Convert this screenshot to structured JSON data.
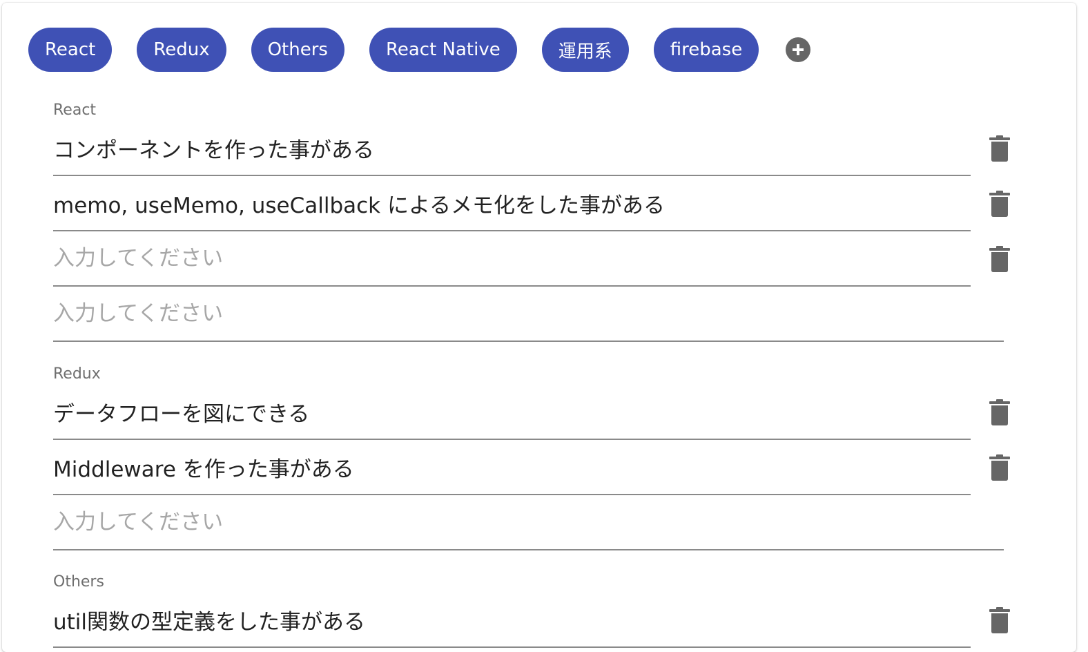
{
  "tabs": [
    {
      "label": "React"
    },
    {
      "label": "Redux"
    },
    {
      "label": "Others"
    },
    {
      "label": "React Native"
    },
    {
      "label": "運用系"
    },
    {
      "label": "firebase"
    }
  ],
  "sections": [
    {
      "label": "React",
      "items": [
        {
          "value": "コンポーネントを作った事がある",
          "placeholder": "入力してください"
        },
        {
          "value": "memo, useMemo, useCallback によるメモ化をした事がある",
          "placeholder": "入力してください"
        },
        {
          "value": "",
          "placeholder": "入力してください"
        }
      ],
      "new_item": {
        "value": "",
        "placeholder": "入力してください"
      }
    },
    {
      "label": "Redux",
      "items": [
        {
          "value": "データフローを図にできる",
          "placeholder": "入力してください"
        },
        {
          "value": "Middleware を作った事がある",
          "placeholder": "入力してください"
        }
      ],
      "new_item": {
        "value": "",
        "placeholder": "入力してください"
      }
    },
    {
      "label": "Others",
      "items": [
        {
          "value": "util関数の型定義をした事がある",
          "placeholder": "入力してください"
        }
      ]
    }
  ],
  "icons": {
    "add": "add-circle-icon",
    "delete": "trash-icon"
  },
  "colors": {
    "chip_background": "#3f51b5",
    "chip_text": "#ffffff",
    "icon": "#666666",
    "label": "#6f6f6f",
    "underline": "#8a8a8a"
  }
}
